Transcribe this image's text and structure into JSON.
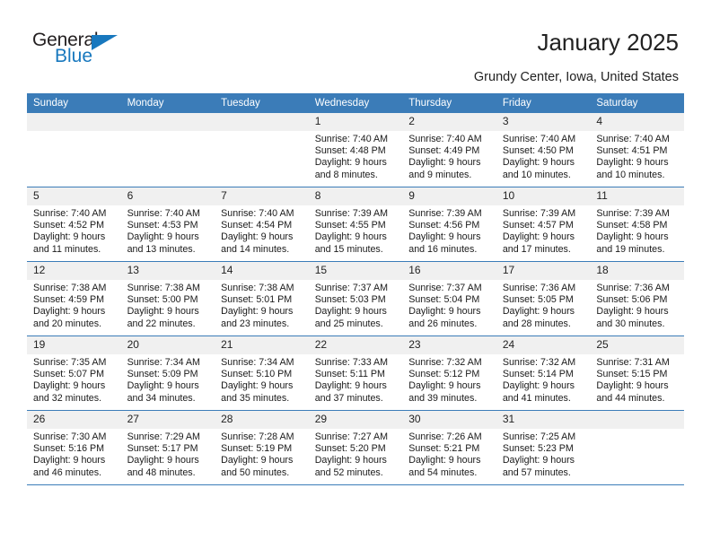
{
  "brand": {
    "name_top": "General",
    "name_bottom": "Blue",
    "triangle_color": "#1878be",
    "text_color": "#231f20"
  },
  "header": {
    "title": "January 2025",
    "subtitle": "Grundy Center, Iowa, United States"
  },
  "theme": {
    "header_bg": "#3b7cb8",
    "header_text": "#ffffff",
    "daynum_bg": "#f0f0f0",
    "grid_line": "#3b7cb8",
    "page_bg": "#ffffff"
  },
  "calendar": {
    "weekday_headers": [
      "Sunday",
      "Monday",
      "Tuesday",
      "Wednesday",
      "Thursday",
      "Friday",
      "Saturday"
    ],
    "weeks": [
      [
        {
          "day": "",
          "empty": true
        },
        {
          "day": "",
          "empty": true
        },
        {
          "day": "",
          "empty": true
        },
        {
          "day": "1",
          "sunrise": "Sunrise: 7:40 AM",
          "sunset": "Sunset: 4:48 PM",
          "daylight1": "Daylight: 9 hours",
          "daylight2": "and 8 minutes."
        },
        {
          "day": "2",
          "sunrise": "Sunrise: 7:40 AM",
          "sunset": "Sunset: 4:49 PM",
          "daylight1": "Daylight: 9 hours",
          "daylight2": "and 9 minutes."
        },
        {
          "day": "3",
          "sunrise": "Sunrise: 7:40 AM",
          "sunset": "Sunset: 4:50 PM",
          "daylight1": "Daylight: 9 hours",
          "daylight2": "and 10 minutes."
        },
        {
          "day": "4",
          "sunrise": "Sunrise: 7:40 AM",
          "sunset": "Sunset: 4:51 PM",
          "daylight1": "Daylight: 9 hours",
          "daylight2": "and 10 minutes."
        }
      ],
      [
        {
          "day": "5",
          "sunrise": "Sunrise: 7:40 AM",
          "sunset": "Sunset: 4:52 PM",
          "daylight1": "Daylight: 9 hours",
          "daylight2": "and 11 minutes."
        },
        {
          "day": "6",
          "sunrise": "Sunrise: 7:40 AM",
          "sunset": "Sunset: 4:53 PM",
          "daylight1": "Daylight: 9 hours",
          "daylight2": "and 13 minutes."
        },
        {
          "day": "7",
          "sunrise": "Sunrise: 7:40 AM",
          "sunset": "Sunset: 4:54 PM",
          "daylight1": "Daylight: 9 hours",
          "daylight2": "and 14 minutes."
        },
        {
          "day": "8",
          "sunrise": "Sunrise: 7:39 AM",
          "sunset": "Sunset: 4:55 PM",
          "daylight1": "Daylight: 9 hours",
          "daylight2": "and 15 minutes."
        },
        {
          "day": "9",
          "sunrise": "Sunrise: 7:39 AM",
          "sunset": "Sunset: 4:56 PM",
          "daylight1": "Daylight: 9 hours",
          "daylight2": "and 16 minutes."
        },
        {
          "day": "10",
          "sunrise": "Sunrise: 7:39 AM",
          "sunset": "Sunset: 4:57 PM",
          "daylight1": "Daylight: 9 hours",
          "daylight2": "and 17 minutes."
        },
        {
          "day": "11",
          "sunrise": "Sunrise: 7:39 AM",
          "sunset": "Sunset: 4:58 PM",
          "daylight1": "Daylight: 9 hours",
          "daylight2": "and 19 minutes."
        }
      ],
      [
        {
          "day": "12",
          "sunrise": "Sunrise: 7:38 AM",
          "sunset": "Sunset: 4:59 PM",
          "daylight1": "Daylight: 9 hours",
          "daylight2": "and 20 minutes."
        },
        {
          "day": "13",
          "sunrise": "Sunrise: 7:38 AM",
          "sunset": "Sunset: 5:00 PM",
          "daylight1": "Daylight: 9 hours",
          "daylight2": "and 22 minutes."
        },
        {
          "day": "14",
          "sunrise": "Sunrise: 7:38 AM",
          "sunset": "Sunset: 5:01 PM",
          "daylight1": "Daylight: 9 hours",
          "daylight2": "and 23 minutes."
        },
        {
          "day": "15",
          "sunrise": "Sunrise: 7:37 AM",
          "sunset": "Sunset: 5:03 PM",
          "daylight1": "Daylight: 9 hours",
          "daylight2": "and 25 minutes."
        },
        {
          "day": "16",
          "sunrise": "Sunrise: 7:37 AM",
          "sunset": "Sunset: 5:04 PM",
          "daylight1": "Daylight: 9 hours",
          "daylight2": "and 26 minutes."
        },
        {
          "day": "17",
          "sunrise": "Sunrise: 7:36 AM",
          "sunset": "Sunset: 5:05 PM",
          "daylight1": "Daylight: 9 hours",
          "daylight2": "and 28 minutes."
        },
        {
          "day": "18",
          "sunrise": "Sunrise: 7:36 AM",
          "sunset": "Sunset: 5:06 PM",
          "daylight1": "Daylight: 9 hours",
          "daylight2": "and 30 minutes."
        }
      ],
      [
        {
          "day": "19",
          "sunrise": "Sunrise: 7:35 AM",
          "sunset": "Sunset: 5:07 PM",
          "daylight1": "Daylight: 9 hours",
          "daylight2": "and 32 minutes."
        },
        {
          "day": "20",
          "sunrise": "Sunrise: 7:34 AM",
          "sunset": "Sunset: 5:09 PM",
          "daylight1": "Daylight: 9 hours",
          "daylight2": "and 34 minutes."
        },
        {
          "day": "21",
          "sunrise": "Sunrise: 7:34 AM",
          "sunset": "Sunset: 5:10 PM",
          "daylight1": "Daylight: 9 hours",
          "daylight2": "and 35 minutes."
        },
        {
          "day": "22",
          "sunrise": "Sunrise: 7:33 AM",
          "sunset": "Sunset: 5:11 PM",
          "daylight1": "Daylight: 9 hours",
          "daylight2": "and 37 minutes."
        },
        {
          "day": "23",
          "sunrise": "Sunrise: 7:32 AM",
          "sunset": "Sunset: 5:12 PM",
          "daylight1": "Daylight: 9 hours",
          "daylight2": "and 39 minutes."
        },
        {
          "day": "24",
          "sunrise": "Sunrise: 7:32 AM",
          "sunset": "Sunset: 5:14 PM",
          "daylight1": "Daylight: 9 hours",
          "daylight2": "and 41 minutes."
        },
        {
          "day": "25",
          "sunrise": "Sunrise: 7:31 AM",
          "sunset": "Sunset: 5:15 PM",
          "daylight1": "Daylight: 9 hours",
          "daylight2": "and 44 minutes."
        }
      ],
      [
        {
          "day": "26",
          "sunrise": "Sunrise: 7:30 AM",
          "sunset": "Sunset: 5:16 PM",
          "daylight1": "Daylight: 9 hours",
          "daylight2": "and 46 minutes."
        },
        {
          "day": "27",
          "sunrise": "Sunrise: 7:29 AM",
          "sunset": "Sunset: 5:17 PM",
          "daylight1": "Daylight: 9 hours",
          "daylight2": "and 48 minutes."
        },
        {
          "day": "28",
          "sunrise": "Sunrise: 7:28 AM",
          "sunset": "Sunset: 5:19 PM",
          "daylight1": "Daylight: 9 hours",
          "daylight2": "and 50 minutes."
        },
        {
          "day": "29",
          "sunrise": "Sunrise: 7:27 AM",
          "sunset": "Sunset: 5:20 PM",
          "daylight1": "Daylight: 9 hours",
          "daylight2": "and 52 minutes."
        },
        {
          "day": "30",
          "sunrise": "Sunrise: 7:26 AM",
          "sunset": "Sunset: 5:21 PM",
          "daylight1": "Daylight: 9 hours",
          "daylight2": "and 54 minutes."
        },
        {
          "day": "31",
          "sunrise": "Sunrise: 7:25 AM",
          "sunset": "Sunset: 5:23 PM",
          "daylight1": "Daylight: 9 hours",
          "daylight2": "and 57 minutes."
        },
        {
          "day": "",
          "empty": true
        }
      ]
    ]
  }
}
